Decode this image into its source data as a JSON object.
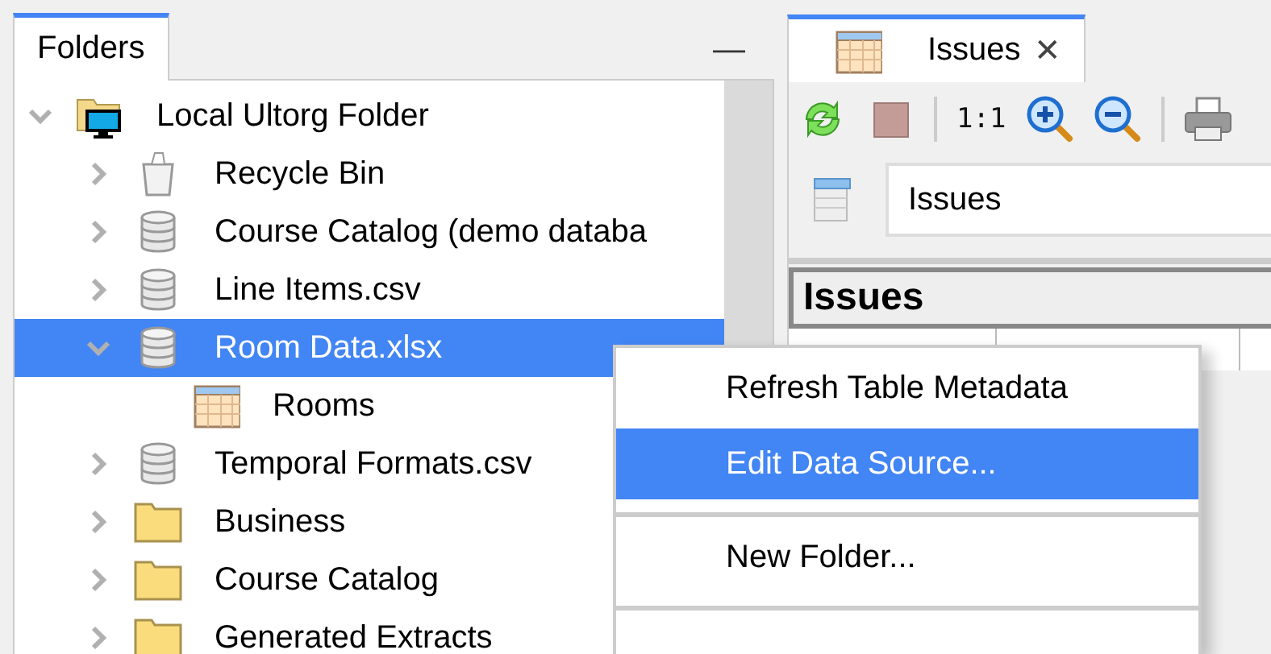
{
  "folders_panel": {
    "tab": {
      "label": "Folders",
      "selected": true
    },
    "minimize": "—",
    "tree": [
      {
        "label": "Local Ultorg Folder",
        "kind": "computer-folder",
        "expanded": true,
        "selected": false,
        "children": [
          {
            "label": "Recycle Bin",
            "kind": "trash",
            "expanded": false,
            "selected": false
          },
          {
            "label": "Course Catalog (demo databa",
            "kind": "database",
            "expanded": false,
            "selected": false
          },
          {
            "label": "Line Items.csv",
            "kind": "database",
            "expanded": false,
            "selected": false
          },
          {
            "label": "Room Data.xlsx",
            "kind": "database",
            "expanded": true,
            "selected": true,
            "children": [
              {
                "label": "Rooms",
                "kind": "table",
                "selected": false
              }
            ]
          },
          {
            "label": "Temporal Formats.csv",
            "kind": "database",
            "expanded": false,
            "selected": false
          },
          {
            "label": "Business",
            "kind": "folder",
            "expanded": false,
            "selected": false
          },
          {
            "label": "Course Catalog",
            "kind": "folder",
            "expanded": false,
            "selected": false
          },
          {
            "label": "Generated Extracts",
            "kind": "folder",
            "expanded": false,
            "selected": false
          }
        ]
      }
    ]
  },
  "editor": {
    "tab": {
      "label": "Issues",
      "selected": true,
      "close": "✕"
    },
    "toolbar": [
      {
        "kind": "refresh"
      },
      {
        "kind": "stop"
      },
      {
        "kind": "separator"
      },
      {
        "kind": "text",
        "label": "1:1"
      },
      {
        "kind": "zoom-in"
      },
      {
        "kind": "zoom-out"
      },
      {
        "kind": "separator"
      },
      {
        "kind": "print"
      }
    ],
    "query_field": {
      "value": "Issues"
    },
    "table": {
      "title": "Issues"
    }
  },
  "context_menu": {
    "items": [
      {
        "kind": "item",
        "label": "Refresh Table Metadata",
        "selected": false
      },
      {
        "kind": "item",
        "label": "Edit Data Source...",
        "selected": true
      },
      {
        "kind": "separator"
      },
      {
        "kind": "item",
        "label": "New Folder...",
        "selected": false
      },
      {
        "kind": "separator"
      }
    ]
  }
}
